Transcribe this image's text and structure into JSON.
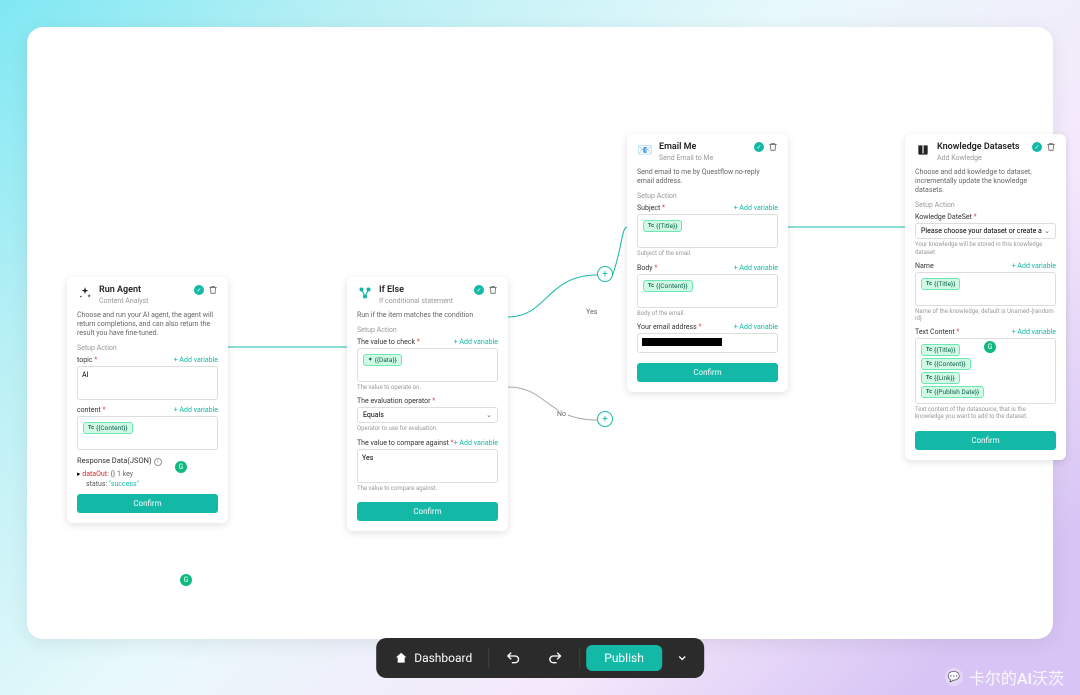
{
  "toolbar": {
    "dashboard": "Dashboard",
    "publish": "Publish"
  },
  "common": {
    "setup_action": "Setup Action",
    "add_variable": "+ Add variable",
    "confirm": "Confirm"
  },
  "edge": {
    "yes": "Yes",
    "no": "No"
  },
  "n1": {
    "title": "Run Agent",
    "subtitle": "Content Analyst",
    "desc": "Choose and run your AI agent, the agent will return completions, and can also return the result you have fine-tuned.",
    "f_topic": "topic",
    "v_topic": "AI",
    "f_content": "content",
    "chip_content": "{{Content}}",
    "resp_title": "Response Data(JSON)",
    "resp_k": "dataOut:",
    "resp_b": "{} 1 key",
    "resp_k2": "status:",
    "resp_v": "\"success\""
  },
  "n2": {
    "title": "If Else",
    "subtitle": "If conditional statement",
    "desc": "Run if the item matches the condition",
    "f1": "The value to check",
    "chip1": "{{Data}}",
    "h1": "The value to operate on.",
    "f2": "The evaluation operator",
    "sel2": "Equals",
    "h2": "Operator to use for evaluation.",
    "f3": "The value to compare against",
    "v3": "Yes",
    "h3": "The value to compare against."
  },
  "n3": {
    "title": "Email Me",
    "subtitle": "Send Email to Me",
    "desc": "Send email to me by Questflow no-reply email address.",
    "f1": "Subject",
    "chip1": "{{Title}}",
    "h1": "Subject of the email.",
    "f2": "Body",
    "chip2": "{{Content}}",
    "h2": "Body of the email.",
    "f3": "Your email address"
  },
  "n4": {
    "title": "Knowledge Datasets",
    "subtitle": "Add Kowledge",
    "desc": "Choose and add kowledge to dataset, incrementally update the knowledge datasets.",
    "f1": "Kowledge DateSet",
    "sel1": "Please choose your dataset or create a ne",
    "h1": "Your knowledge will be stored in this knowledge dataset",
    "f2": "Name",
    "chip2": "{{Title}}",
    "h2": "Name of the knowledge, default is Unamed-{random id}",
    "f3": "Text Content",
    "chip3a": "{{Title}}",
    "chip3b": "{{Content}}",
    "chip3c": "{{Link}}",
    "chip3d": "{{Publish Date}}",
    "h3": "Text content of the datasource, that is the knowledge you want to add to the dataset."
  },
  "watermark": "卡尔的AI沃茨",
  "watermark_sub": "卡尔的AI沃茨"
}
